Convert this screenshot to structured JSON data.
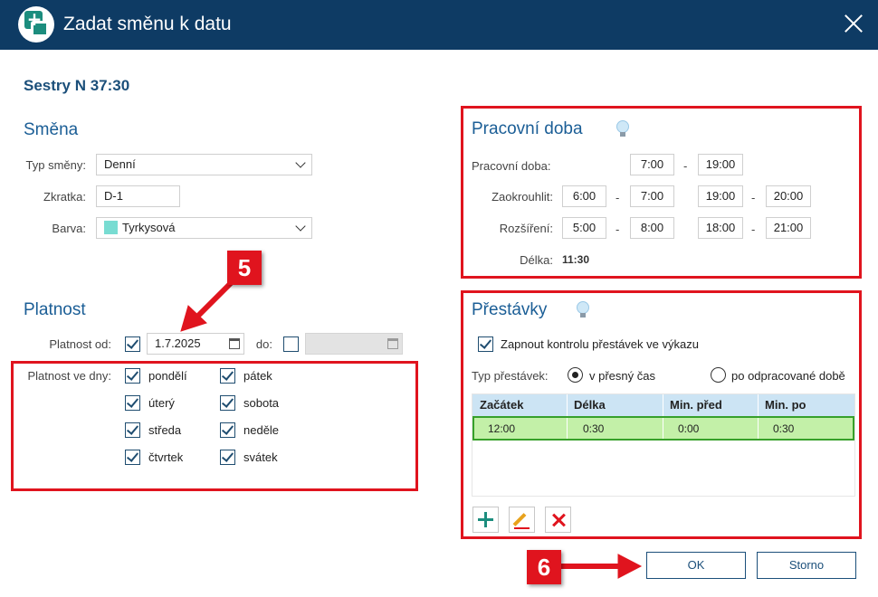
{
  "window": {
    "title": "Zadat směnu k datu"
  },
  "shift_name": "Sestry N 37:30",
  "smena": {
    "heading": "Směna",
    "type_label": "Typ směny:",
    "type_value": "Denní",
    "abbr_label": "Zkratka:",
    "abbr_value": "D-1",
    "color_label": "Barva:",
    "color_value": "Tyrkysová",
    "color_hex": "#78dcd2"
  },
  "platnost": {
    "heading": "Platnost",
    "from_label": "Platnost od:",
    "from_checked": true,
    "from_value": "1.7.2025",
    "to_label": "do:",
    "to_checked": false,
    "to_value": "",
    "days_label": "Platnost ve dny:",
    "days": [
      {
        "label": "pondělí",
        "checked": true
      },
      {
        "label": "úterý",
        "checked": true
      },
      {
        "label": "středa",
        "checked": true
      },
      {
        "label": "čtvrtek",
        "checked": true
      },
      {
        "label": "pátek",
        "checked": true
      },
      {
        "label": "sobota",
        "checked": true
      },
      {
        "label": "neděle",
        "checked": true
      },
      {
        "label": "svátek",
        "checked": true
      }
    ]
  },
  "pracovni_doba": {
    "heading": "Pracovní doba",
    "work_label": "Pracovní doba:",
    "work_from": "7:00",
    "work_to": "19:00",
    "round_label": "Zaokrouhlit:",
    "round_values": [
      "6:00",
      "7:00",
      "19:00",
      "20:00"
    ],
    "extend_label": "Rozšíření:",
    "extend_values": [
      "5:00",
      "8:00",
      "18:00",
      "21:00"
    ],
    "length_label": "Délka:",
    "length_value": "11:30",
    "separator": "-"
  },
  "prestavky": {
    "heading": "Přestávky",
    "enable_label": "Zapnout kontrolu přestávek ve výkazu",
    "enable_checked": true,
    "type_label": "Typ přestávek:",
    "type_options": [
      "v přesný čas",
      "po odpracované době"
    ],
    "type_selected": 0,
    "columns": [
      "Začátek",
      "Délka",
      "Min. před",
      "Min. po"
    ],
    "rows": [
      [
        "12:00",
        "0:30",
        "0:00",
        "0:30"
      ]
    ]
  },
  "buttons": {
    "ok": "OK",
    "cancel": "Storno"
  },
  "callouts": {
    "five": "5",
    "six": "6"
  },
  "colors": {
    "titlebar": "#0e3b64",
    "highlight": "#e0141e",
    "row_selected": "#c3f0a8",
    "accent": "#1b4f7a"
  }
}
